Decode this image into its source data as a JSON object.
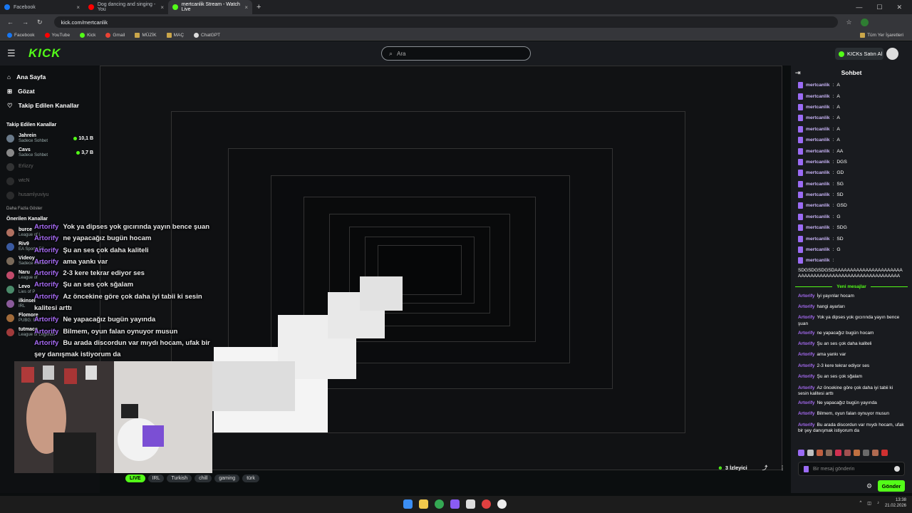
{
  "browser": {
    "tabs": [
      {
        "label": "Facebook",
        "color": "#1877f2"
      },
      {
        "label": "Dog dancing and singing - You",
        "color": "#ff0000"
      },
      {
        "label": "mertcanlik Stream - Watch Live",
        "color": "#53fc18"
      }
    ],
    "url": "kick.com/mertcanlik",
    "bookmarks": [
      "Facebook",
      "YouTube",
      "Kick",
      "Gmail",
      "MÜZİK",
      "MAÇ",
      "ChatGPT"
    ],
    "bookmarks_right": "Tüm Yer İşaretleri"
  },
  "header": {
    "logo": "KICK",
    "search_placeholder": "Ara",
    "buy_kicks": "KICKs Satın Al"
  },
  "sidebar": {
    "nav": [
      {
        "label": "Ana Sayfa",
        "icon": "home-icon"
      },
      {
        "label": "Gözat",
        "icon": "browse-icon"
      },
      {
        "label": "Takip Edilen Kanallar",
        "icon": "heart-icon"
      }
    ],
    "followed_title": "Takip Edilen Kanallar",
    "followed": [
      {
        "name": "Jahrein",
        "sub": "Sadece Sohbet",
        "viewers": "10,1 B",
        "live": true
      },
      {
        "name": "Cavs",
        "sub": "Sadece Sohbet",
        "viewers": "3,7 B",
        "live": true
      },
      {
        "name": "Erlizzy",
        "sub": "",
        "viewers": "",
        "live": false
      },
      {
        "name": "wtcN",
        "sub": "",
        "viewers": "",
        "live": false
      },
      {
        "name": "husamlyuviyu",
        "sub": "",
        "viewers": "",
        "live": false
      }
    ],
    "more": "Daha Fazla Göster",
    "recommended_title": "Önerilen Kanallar",
    "recommended": [
      {
        "name": "burce",
        "sub": "League of L"
      },
      {
        "name": "Riv9",
        "sub": "EA Sports FC"
      },
      {
        "name": "Videoy",
        "sub": "Sadece Sohbet"
      },
      {
        "name": "Naru",
        "sub": "League of"
      },
      {
        "name": "Levo",
        "sub": "Lies of P"
      },
      {
        "name": "ilkinsel",
        "sub": "IRL"
      },
      {
        "name": "Flomore",
        "sub": "PUBG: BATT"
      },
      {
        "name": "tutmacc",
        "sub": "League of Legends"
      }
    ]
  },
  "stream_overlay_chat": [
    {
      "user": "Artorify",
      "msg": "Yok ya dipses yok gıcırında yayın bence şuan"
    },
    {
      "user": "Artorify",
      "msg": "ne yapacağız bugün hocam"
    },
    {
      "user": "Artorify",
      "msg": "Şu an ses çok daha kaliteli"
    },
    {
      "user": "Artorify",
      "msg": "ama yankı var"
    },
    {
      "user": "Artorify",
      "msg": "2-3 kere tekrar ediyor ses"
    },
    {
      "user": "Artorify",
      "msg": "Şu an ses çok sğalam"
    },
    {
      "user": "Artorify",
      "msg": "Az öncekine göre çok daha iyi tabii ki sesin kalitesi arttı"
    },
    {
      "user": "Artorify",
      "msg": "Ne yapacağız bugün yayında"
    },
    {
      "user": "Artorify",
      "msg": "Bilmem, oyun falan oynuyor musun"
    },
    {
      "user": "Artorify",
      "msg": "Bu arada discordun var mıydı hocam, ufak bir şey danışmak istiyorum da"
    }
  ],
  "stream": {
    "tags": [
      "IRL",
      "Turkish",
      "chill",
      "gaming",
      "türk"
    ],
    "live_badge": "LIVE",
    "viewers": "3 İzleyici"
  },
  "chat": {
    "title": "Sohbet",
    "old_messages": [
      {
        "user": "mertcanlik",
        "text": "A"
      },
      {
        "user": "mertcanlik",
        "text": "A"
      },
      {
        "user": "mertcanlik",
        "text": "A"
      },
      {
        "user": "mertcanlik",
        "text": "A"
      },
      {
        "user": "mertcanlik",
        "text": "A"
      },
      {
        "user": "mertcanlik",
        "text": "A"
      },
      {
        "user": "mertcanlik",
        "text": "AA"
      },
      {
        "user": "mertcanlik",
        "text": "DGS"
      },
      {
        "user": "mertcanlik",
        "text": "GD"
      },
      {
        "user": "mertcanlik",
        "text": "SG"
      },
      {
        "user": "mertcanlik",
        "text": "SD"
      },
      {
        "user": "mertcanlik",
        "text": "GSD"
      },
      {
        "user": "mertcanlik",
        "text": "G"
      },
      {
        "user": "mertcanlik",
        "text": "SDG"
      },
      {
        "user": "mertcanlik",
        "text": "SD"
      },
      {
        "user": "mertcanlik",
        "text": "G"
      },
      {
        "user": "mertcanlik",
        "text": ""
      }
    ],
    "long_message": "SDGSDGSDGSDAAAAAAAAAAAAAAAAAAAAAAAAAAAAAAAAAAAAAAAAAAAAAAAAAAAAAAA",
    "new_messages_label": "Yeni mesajlar",
    "new_messages": [
      {
        "user": "Artorify",
        "text": "İyi yayınlar hocam"
      },
      {
        "user": "Artorify",
        "text": "hangi ayarları"
      },
      {
        "user": "Artorify",
        "text": "Yok ya dipses yok gıcırında yayın bence şuan"
      },
      {
        "user": "Artorify",
        "text": "ne yapacağız bugün hocam"
      },
      {
        "user": "Artorify",
        "text": "Şu an ses çok daha kaliteli"
      },
      {
        "user": "Artorify",
        "text": "ama yankı var"
      },
      {
        "user": "Artorify",
        "text": "2-3 kere tekrar ediyor ses"
      },
      {
        "user": "Artorify",
        "text": "Şu an ses çok sğalam"
      },
      {
        "user": "Artorify",
        "text": "Az öncekine göre çok daha iyi tabii ki sesin kalitesi arttı"
      },
      {
        "user": "Artorify",
        "text": "Ne yapacağız bugün yayında"
      },
      {
        "user": "Artorify",
        "text": "Bilmem, oyun falan oynuyor musun"
      },
      {
        "user": "Artorify",
        "text": "Bu arada discordun var mıydı hocam, ufak bir şey danışmak istiyorum da"
      }
    ],
    "input_placeholder": "Bir mesaj gönderin",
    "send_label": "Gönder"
  },
  "taskbar": {
    "time": "13:38",
    "date": "21.02.2026"
  }
}
